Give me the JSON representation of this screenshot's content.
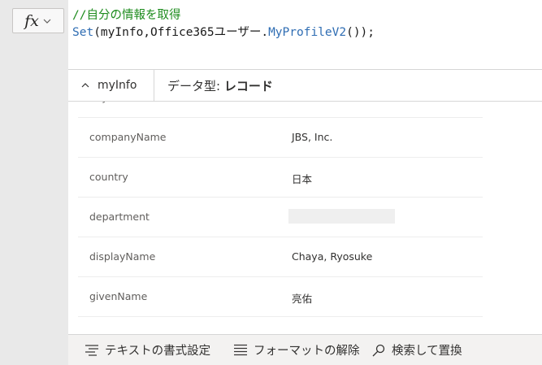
{
  "formula": {
    "fx_label": "fx",
    "line1": "//自分の情報を取得",
    "line2": {
      "fn_set": "Set",
      "args_open": "(myInfo,Office365ユーザー.",
      "fn_profile": "MyProfileV2",
      "args_close": "());"
    }
  },
  "result": {
    "variable_name": "myInfo",
    "type_prefix": "データ型: ",
    "type_value": "レコード",
    "rows": [
      {
        "key": "city",
        "value": ""
      },
      {
        "key": "companyName",
        "value": "JBS, Inc."
      },
      {
        "key": "country",
        "value": "日本"
      },
      {
        "key": "department",
        "value": ""
      },
      {
        "key": "displayName",
        "value": "Chaya, Ryosuke"
      },
      {
        "key": "givenName",
        "value": "亮佑"
      }
    ]
  },
  "toolbar": {
    "format_text": "テキストの書式設定",
    "remove_format": "フォーマットの解除",
    "find_replace": "検索して置換"
  },
  "icons": {
    "fx": "fx-icon",
    "chevron_down": "chevron-down-icon",
    "chevron_up": "chevron-up-icon",
    "format_text": "format-text-icon",
    "remove_format": "remove-format-icon",
    "search": "search-icon"
  },
  "colors": {
    "comment": "#1e8c1e",
    "function": "#2f6db3"
  }
}
